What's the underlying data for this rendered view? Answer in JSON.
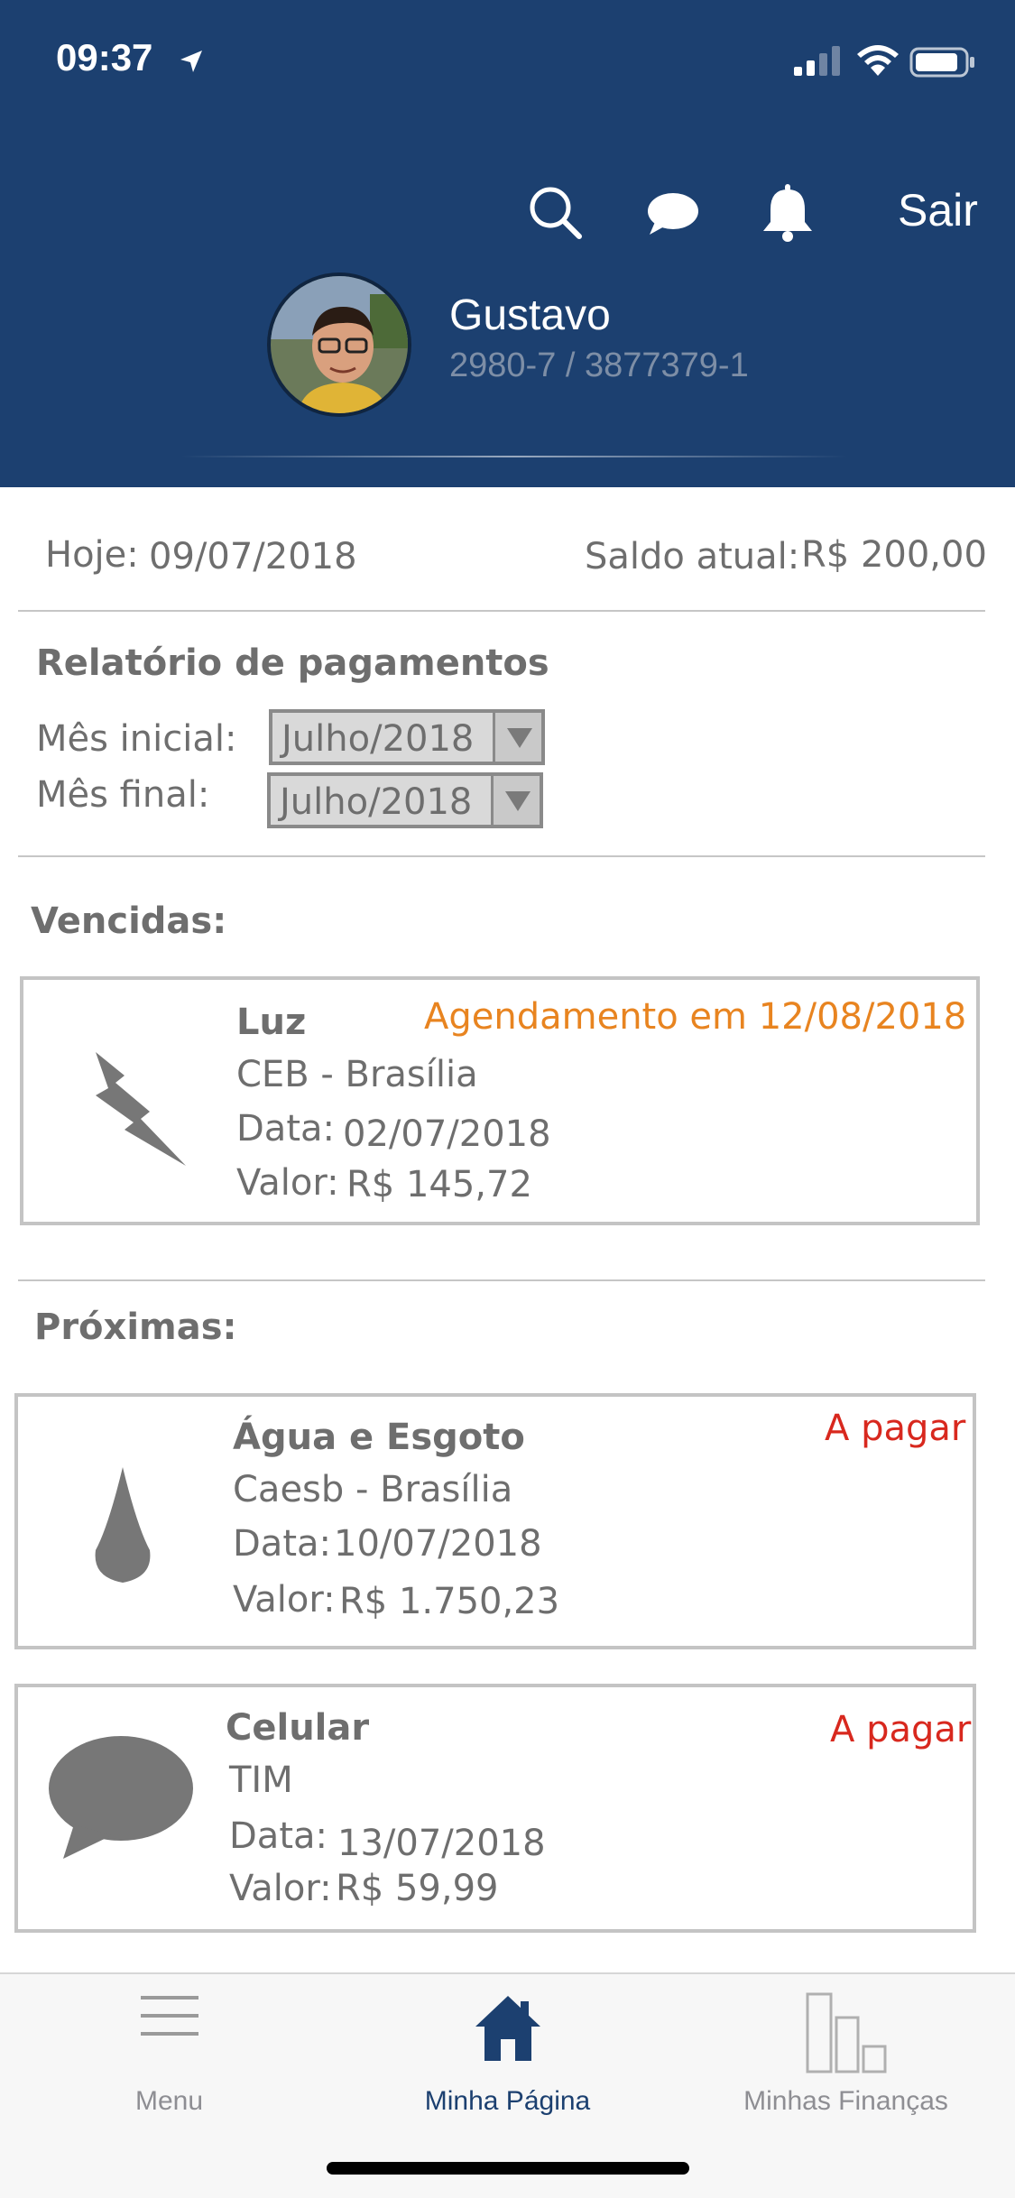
{
  "status_bar": {
    "time": "09:37"
  },
  "header": {
    "logout_label": "Sair",
    "user": {
      "name": "Gustavo",
      "account": "2980-7 / 3877379-1"
    }
  },
  "summary": {
    "today_label": "Hoje:",
    "today_value": "09/07/2018",
    "balance_label": "Saldo atual:",
    "balance_value": "R$ 200,00"
  },
  "report": {
    "title": "Relatório de pagamentos",
    "start_label": "Mês inicial:",
    "start_value": "Julho/2018",
    "end_label": "Mês final:",
    "end_value": "Julho/2018"
  },
  "overdue": {
    "heading": "Vencidas:",
    "items": [
      {
        "icon": "lightning-icon",
        "title": "Luz",
        "provider": "CEB - Brasília",
        "date_label": "Data:",
        "date": "02/07/2018",
        "value_label": "Valor:",
        "value": "R$ 145,72",
        "status": "Agendamento em 12/08/2018",
        "status_color": "#e88420"
      }
    ]
  },
  "upcoming": {
    "heading": "Próximas:",
    "items": [
      {
        "icon": "water-drop-icon",
        "title": "Água e Esgoto",
        "provider": "Caesb - Brasília",
        "date_label": "Data:",
        "date": "10/07/2018",
        "value_label": "Valor:",
        "value": "R$ 1.750,23",
        "status": "A pagar",
        "status_color": "#d8281e"
      },
      {
        "icon": "speech-bubble-icon",
        "title": "Celular",
        "provider": "TIM",
        "date_label": "Data:",
        "date": "13/07/2018",
        "value_label": "Valor:",
        "value": "R$ 59,99",
        "status": "A pagar",
        "status_color": "#d8281e"
      }
    ]
  },
  "tabbar": {
    "tabs": [
      {
        "label": "Menu",
        "icon": "menu-icon",
        "active": false
      },
      {
        "label": "Minha Página",
        "icon": "home-icon",
        "active": true
      },
      {
        "label": "Minhas Finanças",
        "icon": "bar-chart-icon",
        "active": false
      }
    ]
  },
  "colors": {
    "header_bg": "#1c4070",
    "accent": "#1c4070",
    "overdue_status": "#e88420",
    "pending_status": "#d8281e"
  }
}
